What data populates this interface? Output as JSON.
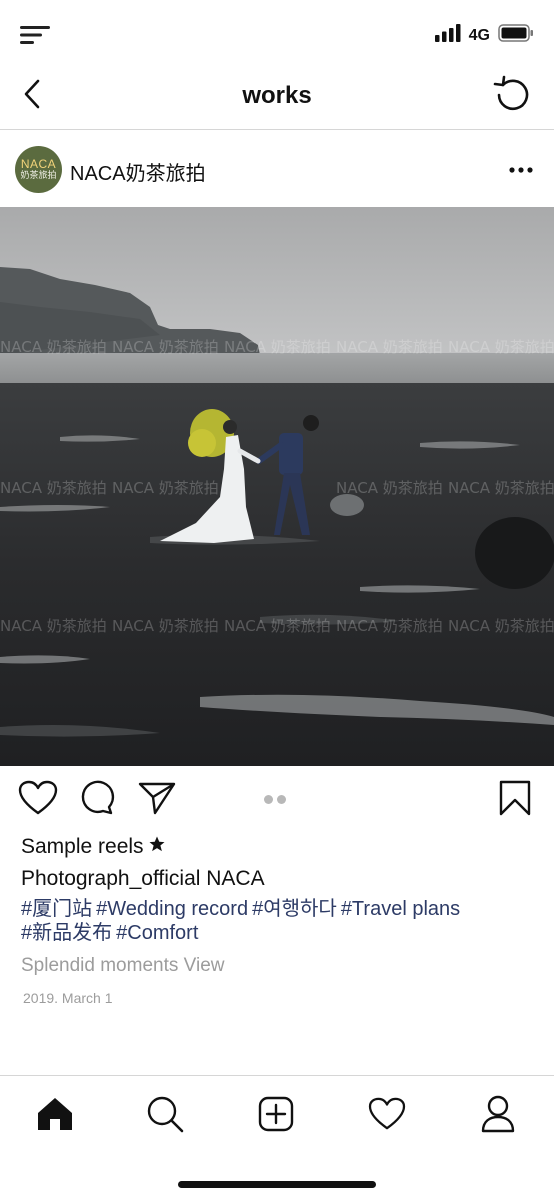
{
  "status_bar": {
    "network": "4G",
    "icons": [
      "menu-icon",
      "signal-icon",
      "battery-icon"
    ]
  },
  "header": {
    "title": "works",
    "back_icon": "chevron-left-icon",
    "refresh_icon": "refresh-icon"
  },
  "post": {
    "account_name": "NACA奶茶旅拍",
    "avatar": {
      "line1": "NACA",
      "line2": "奶茶旅拍"
    },
    "more_icon": "more-horizontal-icon",
    "photo_alt": "",
    "watermark": "NACA 奶茶旅拍",
    "carousel": {
      "pages": 2,
      "current": 1
    },
    "actions": [
      "heart-icon",
      "comment-icon",
      "send-icon",
      "bookmark-icon"
    ]
  },
  "caption": {
    "title": "Sample reels",
    "title_icon": "star-icon",
    "author": "Photograph_official NACA",
    "hashtags": [
      "#厦门站",
      "#Wedding record",
      "#여행하다",
      "#Travel plans",
      "#新品发布",
      "#Comfort"
    ],
    "moments": "Splendid moments View",
    "date": "2019. March 1"
  },
  "tab_bar": {
    "items": [
      "home-icon",
      "search-icon",
      "add-icon",
      "heart-icon",
      "profile-icon"
    ],
    "active": "home-icon"
  },
  "colors": {
    "hashtag": "#2d3b66",
    "muted": "#9c9c9c",
    "avatar_bg": "#5b6b3f",
    "divider": "#d6d6d6"
  }
}
